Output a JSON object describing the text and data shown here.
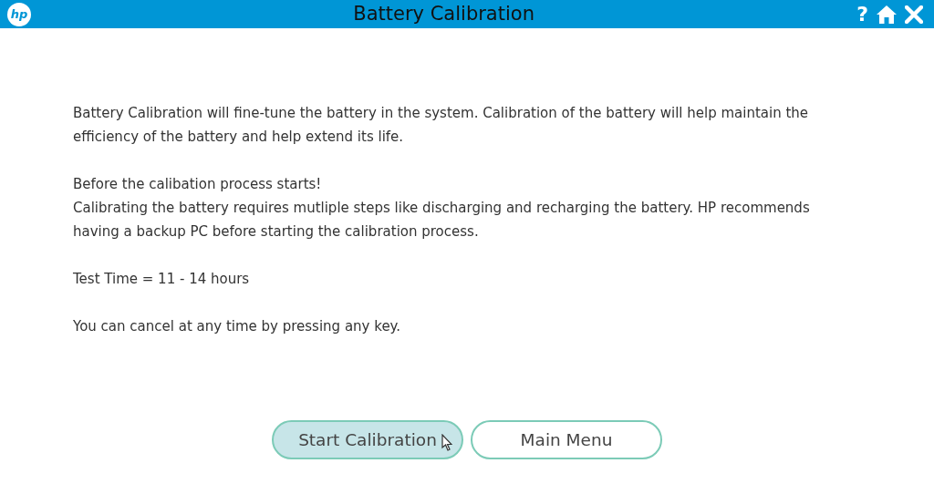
{
  "header": {
    "logo": "hp",
    "title": "Battery Calibration",
    "help": "?"
  },
  "paragraphs": [
    {
      "lines": [
        "Battery Calibration will fine-tune the battery in the system. Calibration of the battery will help maintain the efficiency of the battery and help extend its life."
      ]
    },
    {
      "lines": [
        "Before the calibation process starts!",
        "Calibrating the battery requires mutliple steps like discharging and recharging the battery. HP recommends having a backup PC before starting the calibration process."
      ]
    },
    {
      "lines": [
        "Test Time = 11 - 14 hours"
      ]
    },
    {
      "lines": [
        "You can cancel at any time by pressing any key."
      ]
    }
  ],
  "buttons": [
    {
      "label": "Start Calibration",
      "selected": true
    },
    {
      "label": "Main Menu",
      "selected": false
    }
  ]
}
